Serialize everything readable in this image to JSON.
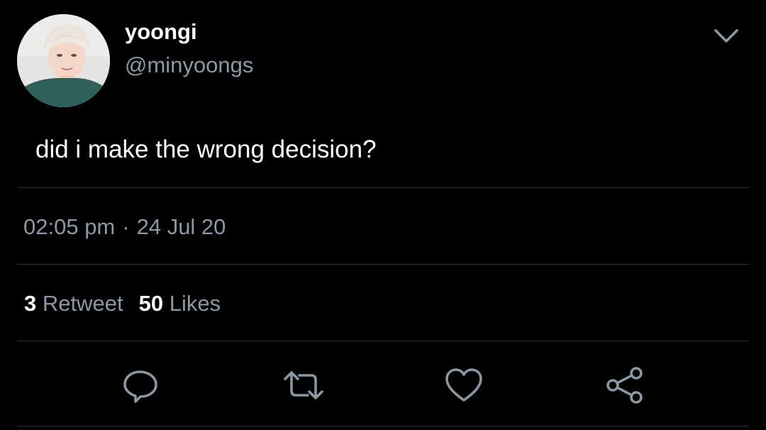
{
  "user": {
    "display_name": "yoongi",
    "handle": "@minyoongs"
  },
  "tweet": {
    "text": "did i make the wrong decision?",
    "time": "02:05 pm",
    "separator": "·",
    "date": "24 Jul 20"
  },
  "stats": {
    "retweet_count": "3",
    "retweet_label": "Retweet",
    "likes_count": "50",
    "likes_label": "Likes"
  },
  "icons": {
    "reply": "reply-icon",
    "retweet": "retweet-icon",
    "like": "heart-icon",
    "share": "share-icon",
    "more": "chevron-down-icon"
  },
  "colors": {
    "background": "#000000",
    "text_primary": "#ffffff",
    "text_secondary": "#8b98a5",
    "divider": "#2f3336",
    "icon": "#8b98a5"
  }
}
